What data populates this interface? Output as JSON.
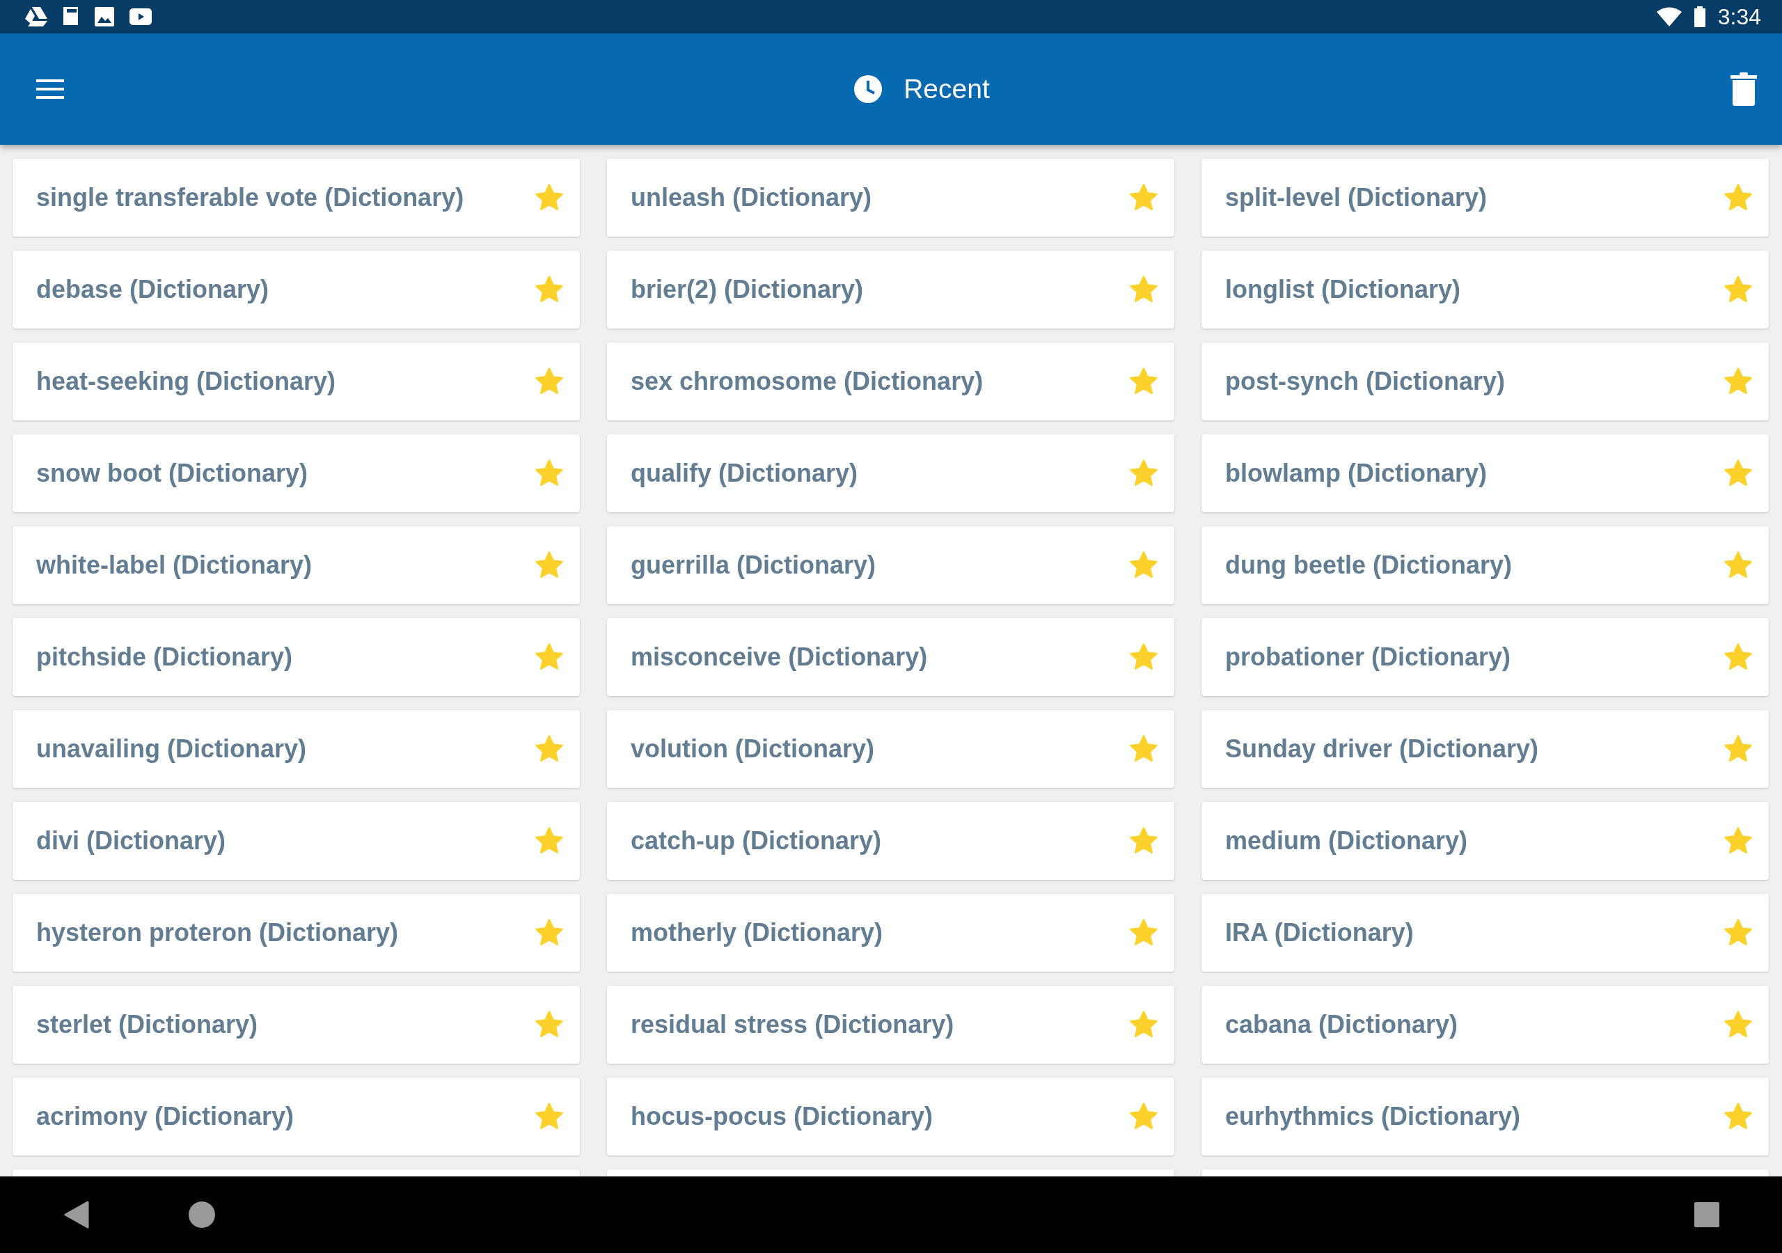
{
  "status_bar": {
    "time": "3:34"
  },
  "app_bar": {
    "title": "Recent"
  },
  "items": [
    {
      "label": "single transferable vote (Dictionary)",
      "starred": true
    },
    {
      "label": "unleash (Dictionary)",
      "starred": true
    },
    {
      "label": "split-level (Dictionary)",
      "starred": true
    },
    {
      "label": "debase (Dictionary)",
      "starred": true
    },
    {
      "label": "brier(2) (Dictionary)",
      "starred": true
    },
    {
      "label": "longlist (Dictionary)",
      "starred": true
    },
    {
      "label": "heat-seeking (Dictionary)",
      "starred": true
    },
    {
      "label": "sex chromosome (Dictionary)",
      "starred": true
    },
    {
      "label": "post-synch (Dictionary)",
      "starred": true
    },
    {
      "label": "snow boot (Dictionary)",
      "starred": true
    },
    {
      "label": "qualify (Dictionary)",
      "starred": true
    },
    {
      "label": "blowlamp (Dictionary)",
      "starred": true
    },
    {
      "label": "white-label (Dictionary)",
      "starred": true
    },
    {
      "label": "guerrilla (Dictionary)",
      "starred": true
    },
    {
      "label": "dung beetle (Dictionary)",
      "starred": true
    },
    {
      "label": "pitchside (Dictionary)",
      "starred": true
    },
    {
      "label": "misconceive (Dictionary)",
      "starred": true
    },
    {
      "label": "probationer (Dictionary)",
      "starred": true
    },
    {
      "label": "unavailing (Dictionary)",
      "starred": true
    },
    {
      "label": "volution (Dictionary)",
      "starred": true
    },
    {
      "label": "Sunday driver (Dictionary)",
      "starred": true
    },
    {
      "label": "divi (Dictionary)",
      "starred": true
    },
    {
      "label": "catch-up (Dictionary)",
      "starred": true
    },
    {
      "label": "medium (Dictionary)",
      "starred": true
    },
    {
      "label": "hysteron proteron (Dictionary)",
      "starred": true
    },
    {
      "label": "motherly (Dictionary)",
      "starred": true
    },
    {
      "label": "IRA (Dictionary)",
      "starred": true
    },
    {
      "label": "sterlet (Dictionary)",
      "starred": true
    },
    {
      "label": "residual stress (Dictionary)",
      "starred": true
    },
    {
      "label": "cabana (Dictionary)",
      "starred": true
    },
    {
      "label": "acrimony (Dictionary)",
      "starred": true
    },
    {
      "label": "hocus-pocus (Dictionary)",
      "starred": true
    },
    {
      "label": "eurhythmics (Dictionary)",
      "starred": true
    }
  ]
}
